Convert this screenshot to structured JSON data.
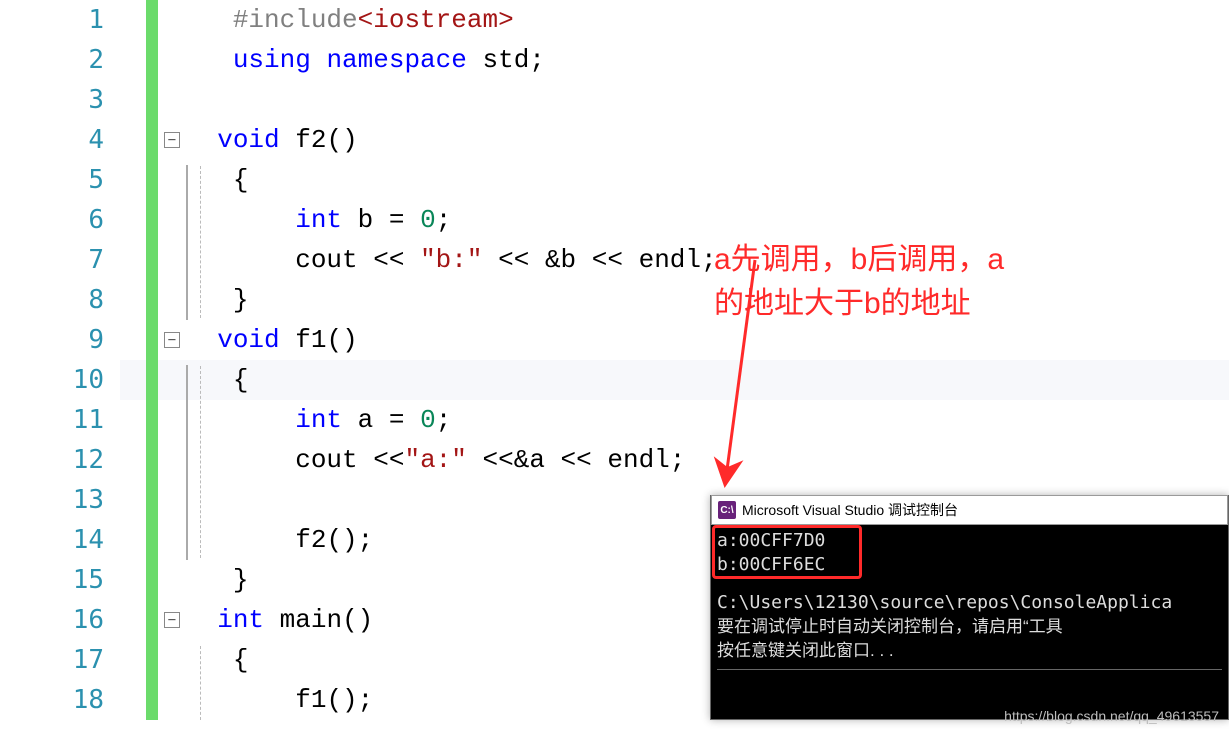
{
  "code": {
    "lines": [
      {
        "n": "1",
        "indent": 1,
        "tokens": [
          [
            "pp",
            "#include"
          ],
          [
            "ang",
            "<iostream>"
          ]
        ]
      },
      {
        "n": "2",
        "indent": 1,
        "tokens": [
          [
            "kw",
            "using"
          ],
          [
            "sp",
            " "
          ],
          [
            "kw",
            "namespace"
          ],
          [
            "sp",
            " "
          ],
          [
            "id",
            "std"
          ],
          [
            "punc",
            ";"
          ]
        ]
      },
      {
        "n": "3",
        "indent": 1,
        "tokens": []
      },
      {
        "n": "4",
        "indent": 0,
        "fold": true,
        "tokens": [
          [
            "kw",
            "void"
          ],
          [
            "sp",
            " "
          ],
          [
            "id",
            "f2"
          ],
          [
            "punc",
            "()"
          ]
        ]
      },
      {
        "n": "5",
        "indent": 1,
        "tokens": [
          [
            "punc",
            "{"
          ]
        ]
      },
      {
        "n": "6",
        "indent": 2,
        "tokens": [
          [
            "kw",
            "int"
          ],
          [
            "sp",
            " "
          ],
          [
            "id",
            "b"
          ],
          [
            "sp",
            " "
          ],
          [
            "op",
            "="
          ],
          [
            "sp",
            " "
          ],
          [
            "num",
            "0"
          ],
          [
            "punc",
            ";"
          ]
        ]
      },
      {
        "n": "7",
        "indent": 2,
        "tokens": [
          [
            "id",
            "cout"
          ],
          [
            "sp",
            " "
          ],
          [
            "op",
            "<<"
          ],
          [
            "sp",
            " "
          ],
          [
            "str",
            "\"b:\""
          ],
          [
            "sp",
            " "
          ],
          [
            "op",
            "<<"
          ],
          [
            "sp",
            " "
          ],
          [
            "op",
            "&"
          ],
          [
            "id",
            "b"
          ],
          [
            "sp",
            " "
          ],
          [
            "op",
            "<<"
          ],
          [
            "sp",
            " "
          ],
          [
            "id",
            "endl"
          ],
          [
            "punc",
            ";"
          ]
        ]
      },
      {
        "n": "8",
        "indent": 1,
        "tokens": [
          [
            "punc",
            "}"
          ]
        ]
      },
      {
        "n": "9",
        "indent": 0,
        "fold": true,
        "tokens": [
          [
            "kw",
            "void"
          ],
          [
            "sp",
            " "
          ],
          [
            "id",
            "f1"
          ],
          [
            "punc",
            "()"
          ]
        ]
      },
      {
        "n": "10",
        "indent": 1,
        "highlight": true,
        "tokens": [
          [
            "punc",
            "{"
          ]
        ]
      },
      {
        "n": "11",
        "indent": 2,
        "tokens": [
          [
            "kw",
            "int"
          ],
          [
            "sp",
            " "
          ],
          [
            "id",
            "a"
          ],
          [
            "sp",
            " "
          ],
          [
            "op",
            "="
          ],
          [
            "sp",
            " "
          ],
          [
            "num",
            "0"
          ],
          [
            "punc",
            ";"
          ]
        ]
      },
      {
        "n": "12",
        "indent": 2,
        "tokens": [
          [
            "id",
            "cout"
          ],
          [
            "sp",
            " "
          ],
          [
            "op",
            "<<"
          ],
          [
            "str",
            "\"a:\""
          ],
          [
            "sp",
            " "
          ],
          [
            "op",
            "<<"
          ],
          [
            "op",
            "&"
          ],
          [
            "id",
            "a"
          ],
          [
            "sp",
            " "
          ],
          [
            "op",
            "<<"
          ],
          [
            "sp",
            " "
          ],
          [
            "id",
            "endl"
          ],
          [
            "punc",
            ";"
          ]
        ]
      },
      {
        "n": "13",
        "indent": 2,
        "tokens": []
      },
      {
        "n": "14",
        "indent": 2,
        "tokens": [
          [
            "id",
            "f2"
          ],
          [
            "punc",
            "();"
          ]
        ]
      },
      {
        "n": "15",
        "indent": 1,
        "tokens": [
          [
            "punc",
            "}"
          ]
        ]
      },
      {
        "n": "16",
        "indent": 0,
        "fold": true,
        "tokens": [
          [
            "kw",
            "int"
          ],
          [
            "sp",
            " "
          ],
          [
            "id",
            "main"
          ],
          [
            "punc",
            "()"
          ]
        ]
      },
      {
        "n": "17",
        "indent": 1,
        "tokens": [
          [
            "punc",
            "{"
          ]
        ]
      },
      {
        "n": "18",
        "indent": 2,
        "tokens": [
          [
            "id",
            "f1"
          ],
          [
            "punc",
            "();"
          ]
        ]
      }
    ]
  },
  "annotation": {
    "line1": "a先调用，b后调用，a",
    "line2": "的地址大于b的地址"
  },
  "console": {
    "title": "Microsoft Visual Studio 调试控制台",
    "icon_label": "C:\\",
    "out1": "a:00CFF7D0",
    "out2": "b:00CFF6EC",
    "path": "C:\\Users\\12130\\source\\repos\\ConsoleApplica",
    "msg1": "要在调试停止时自动关闭控制台，请启用“工具",
    "msg2": "按任意键关闭此窗口. . ."
  },
  "watermark": "https://blog.csdn.net/qq_49613557"
}
